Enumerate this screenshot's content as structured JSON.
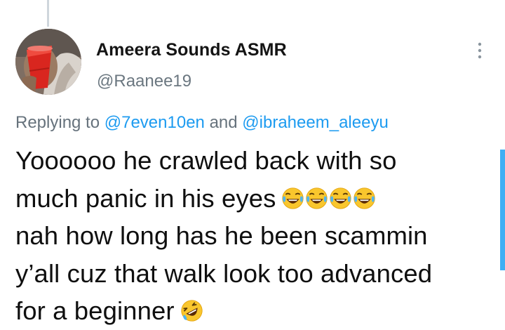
{
  "tweet": {
    "display_name": "Ameera Sounds ASMR",
    "handle": "@Raanee19",
    "replying_prefix": "Replying to",
    "reply_mentions": [
      "@7even10en",
      "@ibraheem_aleeyu"
    ],
    "reply_joiner": "and",
    "body_lines": [
      "Yoooooo he crawled back with so",
      "much panic in his eyes",
      "nah how long has he been scammin",
      "y’all cuz that walk look too advanced",
      "for a beginner"
    ],
    "emojis": {
      "line_2": [
        "face-with-tears-of-joy-icon",
        "face-with-tears-of-joy-icon",
        "face-with-tears-of-joy-icon",
        "face-with-tears-of-joy-icon"
      ],
      "line_5": [
        "rolling-on-floor-laughing-icon"
      ]
    },
    "more_icon": "more-options-icon"
  },
  "colors": {
    "text_primary": "#111111",
    "text_secondary": "#66727c",
    "mention": "#1d9bf0",
    "thread_line": "#cfd6dc",
    "scrollbar": "#1da1f2"
  }
}
